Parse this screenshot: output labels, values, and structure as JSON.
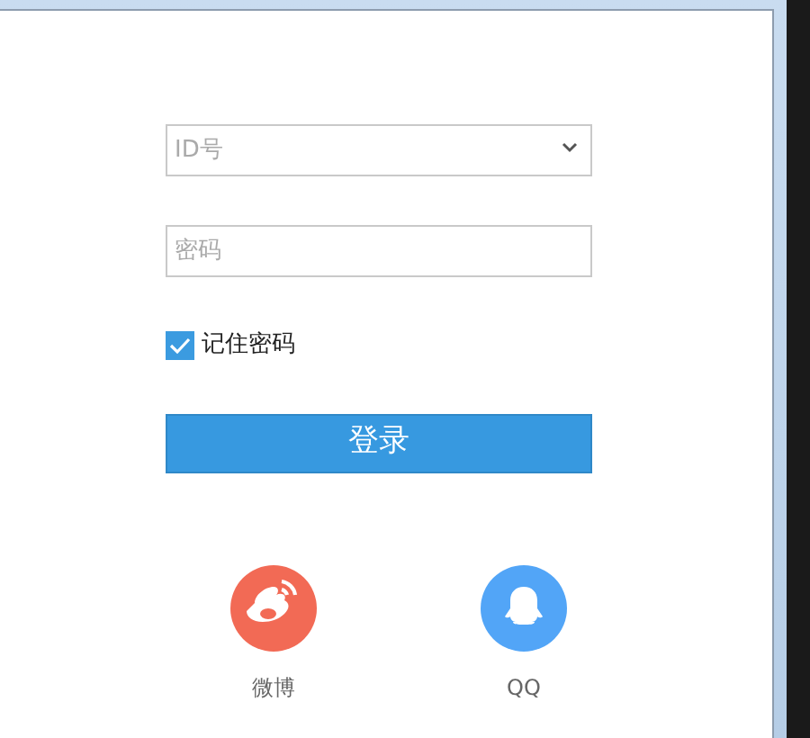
{
  "account_field": {
    "placeholder": "ID号"
  },
  "password_field": {
    "placeholder": "密码"
  },
  "remember_password": {
    "label": "记住密码",
    "checked": true
  },
  "login_button": {
    "label": "登录"
  },
  "social_logins": [
    {
      "kind": "weibo",
      "label": "微博",
      "color": "#f26a55"
    },
    {
      "kind": "qq",
      "label": "QQ",
      "color": "#52a5f7"
    }
  ]
}
